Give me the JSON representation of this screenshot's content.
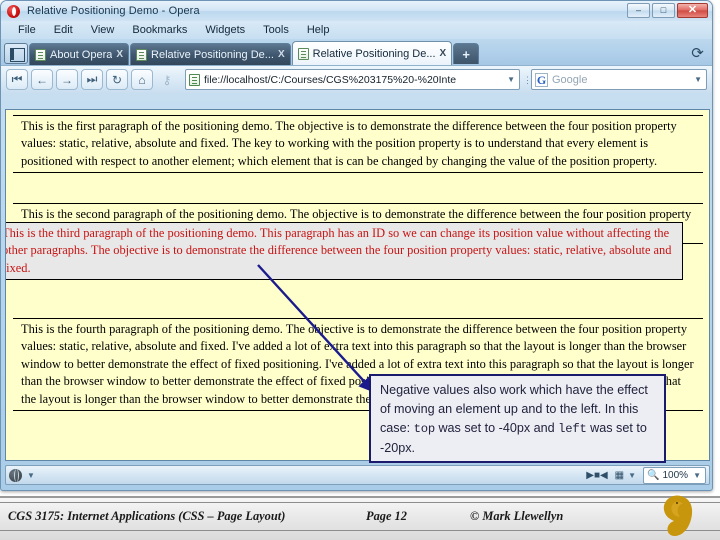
{
  "window": {
    "title": "Relative Positioning Demo - Opera",
    "logo_icon": "opera-logo",
    "controls": {
      "minimize": "–",
      "maximize": "□",
      "close": "✕"
    }
  },
  "menubar": {
    "items": [
      "File",
      "Edit",
      "View",
      "Bookmarks",
      "Widgets",
      "Tools",
      "Help"
    ]
  },
  "tabs": {
    "panel_button_icon": "sidebar-panel-icon",
    "items": [
      {
        "label": "About Opera",
        "icon": "page-icon",
        "close": "X",
        "active": false
      },
      {
        "label": "Relative Positioning De...",
        "icon": "page-icon",
        "close": "X",
        "active": false
      },
      {
        "label": "Relative Positioning De...",
        "icon": "page-icon",
        "close": "X",
        "active": true
      }
    ],
    "new_tab": "+",
    "trash_icon": "trash-undo-icon"
  },
  "navbar": {
    "buttons": [
      {
        "name": "rewind",
        "glyph": "⏮"
      },
      {
        "name": "back",
        "glyph": "←"
      },
      {
        "name": "forward",
        "glyph": "→"
      },
      {
        "name": "fast-forward",
        "glyph": "⏭"
      },
      {
        "name": "reload",
        "glyph": "↻"
      },
      {
        "name": "home",
        "glyph": "⌂"
      },
      {
        "name": "security-key",
        "glyph": "⚷"
      }
    ],
    "url": "file://localhost/C:/Courses/CGS%203175%20-%20Inte",
    "url_icon": "page-icon",
    "url_dropdown": "▼",
    "search_placeholder": "Google",
    "search_icon": "google-g-icon",
    "search_dropdown": "▼"
  },
  "page": {
    "background_color": "#ffffcc",
    "paragraphs": [
      {
        "id": "p1",
        "text": "This is the first paragraph of the positioning demo. The objective is to demonstrate the difference between the four position property values: static, relative, absolute and fixed. The key to working with the position property is to understand that every element is positioned with respect to another element; which element that is can be changed by changing the value of the position property."
      },
      {
        "id": "p2",
        "text": "This is the second paragraph of the positioning demo. The objective is to demonstrate the difference between the four position property values: static, relative, absolute and fixed."
      },
      {
        "id": "p3",
        "text": "This is the third paragraph of the positioning demo. This paragraph has an ID so we can change its position value without affecting the other paragraphs. The objective is to demonstrate the difference between the four position property values: static, relative, absolute and fixed.",
        "text_color": "#c81414",
        "background_color": "#e8e8e8"
      },
      {
        "id": "p4",
        "text": "This is the fourth paragraph of the positioning demo. The objective is to demonstrate the difference between the four position property values: static, relative, absolute and fixed. I've added a lot of extra text into this paragraph so that the layout is longer than the browser window to better demonstrate the effect of fixed positioning. I've added a lot of extra text into this paragraph so that the layout is longer than the browser window to better demonstrate the effect of fixed positioning. I've added a lot of extra text into this paragraph so that the layout is longer than the browser window to better demonstrate the effect of fixed positioning."
      }
    ]
  },
  "statusbar": {
    "globe_icon": "globe-icon",
    "globe_dropdown": "▼",
    "transfer_icon": "transfer-icon",
    "image_icon": "images-icon",
    "image_dropdown": "▼",
    "zoom_icon": "magnifier-icon",
    "zoom_value": "100%",
    "zoom_dropdown": "▼"
  },
  "annotation": {
    "text_part1": "Negative values also work which have the effect of moving an element up and to the left.  In this case: ",
    "code1": "top",
    "text_part2": " was set to -40px and ",
    "code2": "left",
    "text_part3": " was set to -20px.",
    "border_color": "#1b1b6e",
    "arrow_color": "#1b1b8e"
  },
  "footer": {
    "course": "CGS 3175: Internet Applications (CSS – Page Layout)",
    "page": "Page 12",
    "author": "© Mark Llewellyn",
    "logo_icon": "ucf-pegasus-logo",
    "logo_color": "#c8960c"
  }
}
